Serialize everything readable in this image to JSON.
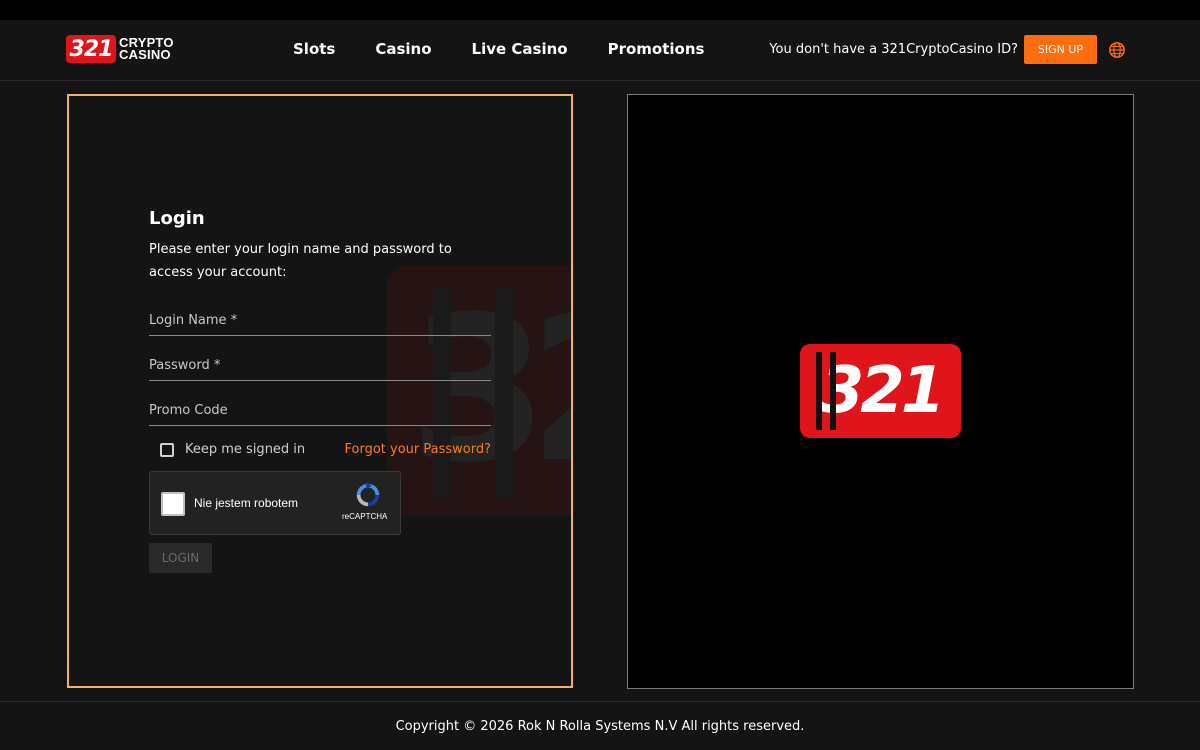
{
  "header": {
    "logo_number": "321",
    "logo_line1": "CRYPTO",
    "logo_line2": "CASINO",
    "nav": [
      "Slots",
      "Casino",
      "Live Casino",
      "Promotions"
    ],
    "signup_prompt": "You don't have a 321CryptoCasino ID?",
    "signup_label": "SIGN UP",
    "language_icon": "globe-icon"
  },
  "login": {
    "title": "Login",
    "description": "Please enter your login name and password to access your account:",
    "fields": {
      "login_name": "Login Name *",
      "password": "Password *",
      "promo_code": "Promo Code"
    },
    "keep_signed_in": "Keep me signed in",
    "forgot_password": "Forgot your Password?",
    "recaptcha": {
      "label": "Nie jestem robotem",
      "brand": "reCAPTCHA"
    },
    "login_button": "LOGIN",
    "watermark_number": "32"
  },
  "promo": {
    "logo_number": "321"
  },
  "footer": {
    "copyright": "Copyright © 2026 Rok N Rolla Systems N.V All rights reserved."
  },
  "colors": {
    "accent": "#ff6d10",
    "brand_red": "#e0141b",
    "panel_border": "#f3b367",
    "link": "#ff7b1a"
  }
}
